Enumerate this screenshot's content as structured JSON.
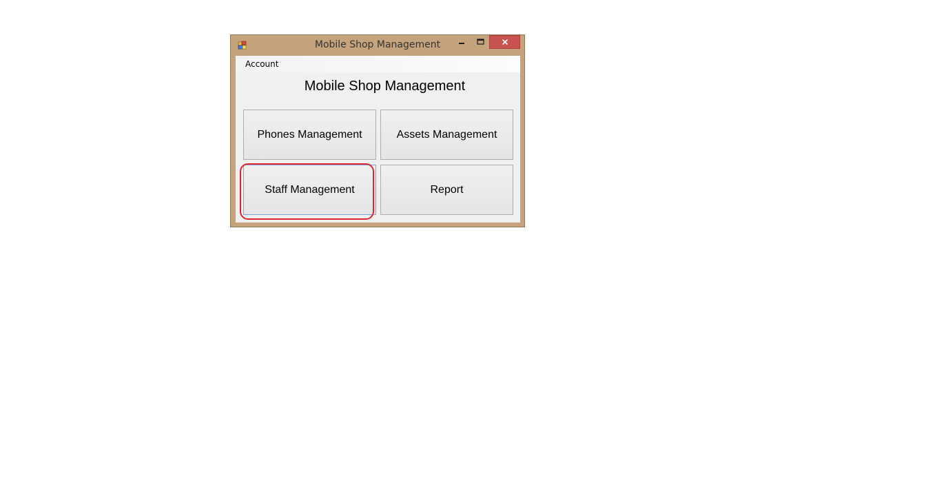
{
  "window": {
    "title": "Mobile Shop Management",
    "close_symbol": "✕"
  },
  "menu": {
    "items": [
      {
        "label": "Account"
      }
    ]
  },
  "main": {
    "heading": "Mobile Shop Management",
    "buttons": [
      {
        "label": "Phones Management"
      },
      {
        "label": "Assets Management"
      },
      {
        "label": "Staff Management"
      },
      {
        "label": "Report"
      }
    ]
  },
  "annotation": {
    "target": "Staff Management",
    "color": "#e0242f"
  },
  "icons": {
    "app": "app-icon",
    "minimize": "minimize-icon",
    "maximize": "maximize-icon",
    "close": "close-icon"
  },
  "colors": {
    "frame": "#c5a37c",
    "close_button": "#c7524e",
    "client_bg": "#f0f0f0"
  }
}
